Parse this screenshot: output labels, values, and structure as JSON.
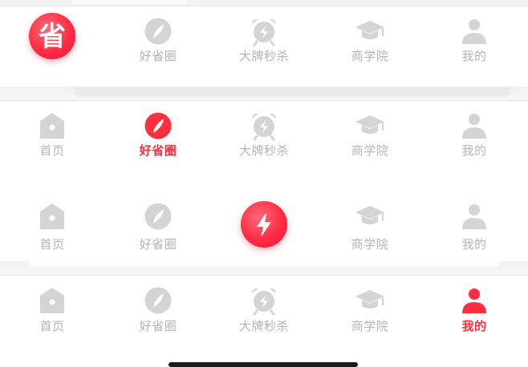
{
  "colors": {
    "active": "#ff2f3f",
    "inactive": "#b4b4b4",
    "icon_gray": "#d4d4d4"
  },
  "bars": [
    {
      "name": "bar-save-center",
      "tabs": [
        {
          "label": "",
          "icon": "save-logo-icon",
          "state": "raised"
        },
        {
          "label": "好省圈",
          "icon": "compass-icon",
          "state": "inactive"
        },
        {
          "label": "大牌秒杀",
          "icon": "alarm-clock-icon",
          "state": "inactive"
        },
        {
          "label": "商学院",
          "icon": "graduation-cap-icon",
          "state": "inactive"
        },
        {
          "label": "我的",
          "icon": "person-icon",
          "state": "inactive"
        }
      ]
    },
    {
      "name": "bar-haoshengquan-active",
      "tabs": [
        {
          "label": "首页",
          "icon": "home-icon",
          "state": "inactive"
        },
        {
          "label": "好省圈",
          "icon": "compass-icon",
          "state": "active"
        },
        {
          "label": "大牌秒杀",
          "icon": "alarm-clock-icon",
          "state": "inactive"
        },
        {
          "label": "商学院",
          "icon": "graduation-cap-icon",
          "state": "inactive"
        },
        {
          "label": "我的",
          "icon": "person-icon",
          "state": "inactive"
        }
      ]
    },
    {
      "name": "bar-flash-center",
      "tabs": [
        {
          "label": "首页",
          "icon": "home-icon",
          "state": "inactive"
        },
        {
          "label": "好省圈",
          "icon": "compass-icon",
          "state": "inactive"
        },
        {
          "label": "",
          "icon": "lightning-icon",
          "state": "raised"
        },
        {
          "label": "商学院",
          "icon": "graduation-cap-icon",
          "state": "inactive"
        },
        {
          "label": "我的",
          "icon": "person-icon",
          "state": "inactive"
        }
      ]
    },
    {
      "name": "bar-mine-active",
      "tabs": [
        {
          "label": "首页",
          "icon": "home-icon",
          "state": "inactive"
        },
        {
          "label": "好省圈",
          "icon": "compass-icon",
          "state": "inactive"
        },
        {
          "label": "大牌秒杀",
          "icon": "alarm-clock-icon",
          "state": "inactive"
        },
        {
          "label": "商学院",
          "icon": "graduation-cap-icon",
          "state": "inactive"
        },
        {
          "label": "我的",
          "icon": "person-icon",
          "state": "active"
        }
      ]
    }
  ],
  "raised_glyphs": {
    "save": "省"
  }
}
